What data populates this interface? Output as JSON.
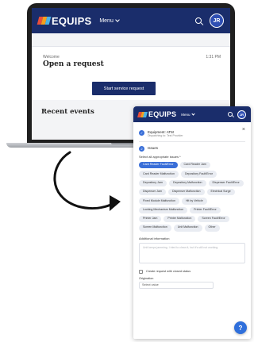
{
  "brand": {
    "logo_text": "EQUIPS",
    "colors": {
      "navy": "#1a2d6b",
      "accent_blue": "#3a6fd8",
      "logo_red": "#e94f3a",
      "logo_orange": "#f4a01d",
      "logo_cyan": "#4bb3e6"
    }
  },
  "desktop": {
    "header": {
      "menu_label": "Menu",
      "avatar_initials": "JR"
    },
    "welcome": {
      "label": "Welcome",
      "time": "1:31 PM",
      "title": "Open a request",
      "start_button": "Start service request"
    },
    "recent_title": "Recent events"
  },
  "mobile": {
    "header": {
      "menu_label": "Menu",
      "avatar_initials": "JR"
    },
    "step1": {
      "title": "Equipment: ATM",
      "subtitle": "Dispatching to: Test Provider"
    },
    "step2": {
      "number": "2",
      "title": "Issues"
    },
    "select_label": "Select all appropriate issues *",
    "issues": [
      {
        "label": "Card Reader Fault/Error",
        "selected": true
      },
      {
        "label": "Card Reader Jam",
        "selected": false
      },
      {
        "label": "Card Reader Malfunction",
        "selected": false
      },
      {
        "label": "Depository Fault/Error",
        "selected": false
      },
      {
        "label": "Depository Jam",
        "selected": false
      },
      {
        "label": "Depository Malfunction",
        "selected": false
      },
      {
        "label": "Dispenser Fault/Error",
        "selected": false
      },
      {
        "label": "Dispenser Jam",
        "selected": false
      },
      {
        "label": "Dispenser Malfunction",
        "selected": false
      },
      {
        "label": "Electrical Surge",
        "selected": false
      },
      {
        "label": "Fixed Module Malfunction",
        "selected": false
      },
      {
        "label": "Hit by Vehicle",
        "selected": false
      },
      {
        "label": "Locking Mechanism Malfunction",
        "selected": false
      },
      {
        "label": "Printer Fault/Error",
        "selected": false
      },
      {
        "label": "Printer Jam",
        "selected": false
      },
      {
        "label": "Printer Malfunction",
        "selected": false
      },
      {
        "label": "Screen Fault/Error",
        "selected": false
      },
      {
        "label": "Screen Malfunction",
        "selected": false
      },
      {
        "label": "Unit Malfunction",
        "selected": false
      },
      {
        "label": "Other",
        "selected": false
      }
    ],
    "additional_info_label": "Additional information",
    "additional_info_placeholder": "Unit keeps jamming. I tried to clean it, but it's still not working.",
    "closed_status_label": "Create request with closed status",
    "origination_label": "Origination",
    "origination_value": "Select value",
    "help_glyph": "?",
    "close_glyph": "×"
  }
}
